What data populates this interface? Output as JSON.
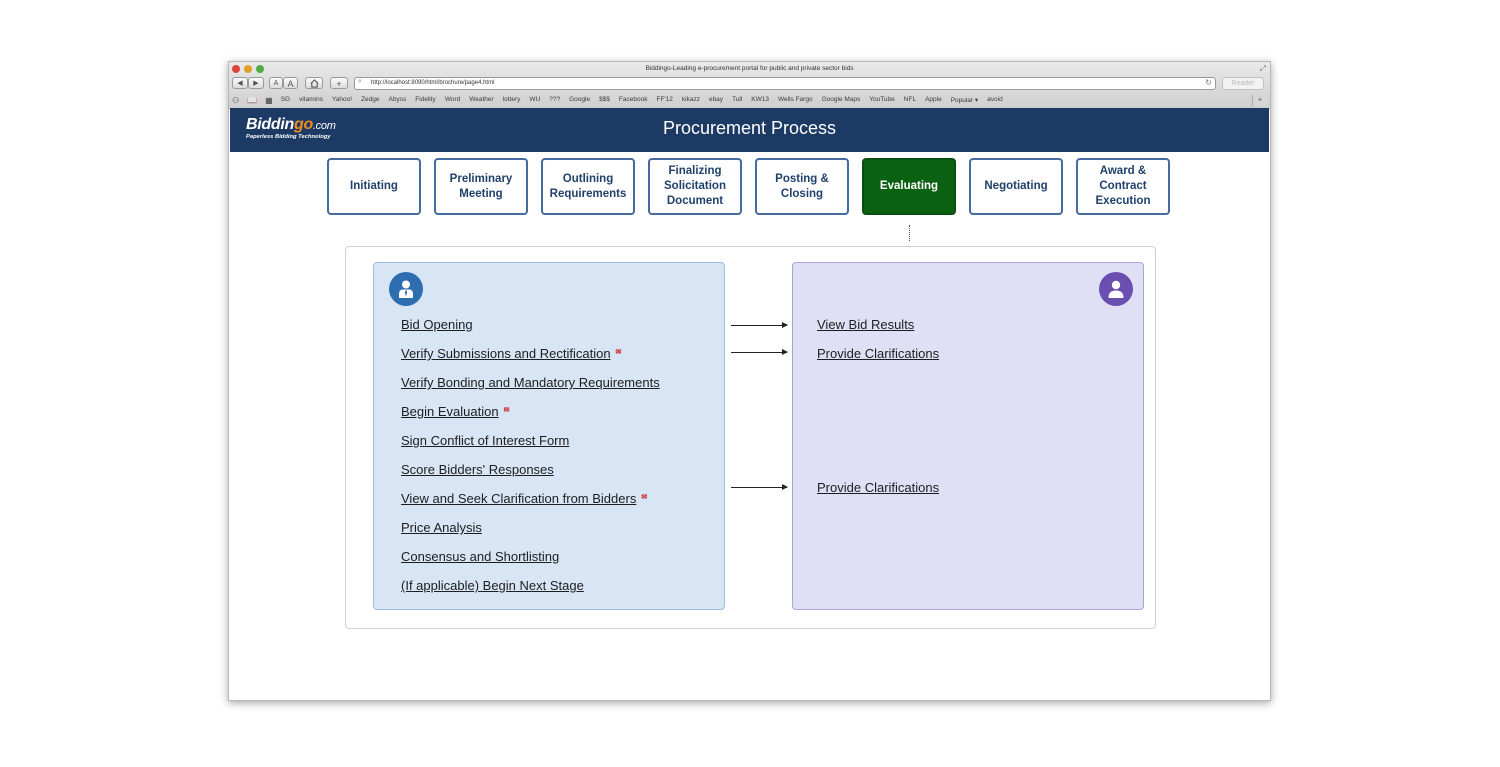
{
  "browser": {
    "window_title": "Biddingo-Leading e-procurement portal for public and private sector bids",
    "url": "http://localhost:8090/html/brochure/page4.html",
    "reader_label": "Reader",
    "font_smaller": "A",
    "font_larger": "A",
    "add_label": "+",
    "bookmarks": [
      "SG",
      "vitamins",
      "Yahoo!",
      "Zedge",
      "Abyss",
      "Fidelity",
      "Word",
      "Weather",
      "lottery",
      "WU",
      "???",
      "Google",
      "$$$",
      "Facebook",
      "FF'12",
      "kikazz",
      "ebay",
      "Tull",
      "KW13",
      "Wells Fargo",
      "Google Maps",
      "YouTube",
      "NFL",
      "Apple",
      "Popular ▾",
      "avoid"
    ]
  },
  "header": {
    "logo_text_1": "Biddin",
    "logo_text_2": "go",
    "logo_text_3": ".com",
    "logo_tagline": "Paperless Bidding Technology",
    "title": "Procurement Process"
  },
  "steps": [
    {
      "label": "Initiating",
      "active": false
    },
    {
      "label": "Preliminary Meeting",
      "active": false
    },
    {
      "label": "Outlining Requirements",
      "active": false
    },
    {
      "label": "Finalizing Solicitation Document",
      "active": false
    },
    {
      "label": "Posting & Closing",
      "active": false
    },
    {
      "label": "Evaluating",
      "active": true
    },
    {
      "label": "Negotiating",
      "active": false
    },
    {
      "label": "Award & Contract Execution",
      "active": false
    }
  ],
  "left_actions": [
    {
      "label": "Bid Opening",
      "mail": false
    },
    {
      "label": "Verify Submissions and Rectification",
      "mail": true
    },
    {
      "label": "Verify Bonding and Mandatory Requirements",
      "mail": false
    },
    {
      "label": "Begin Evaluation",
      "mail": true
    },
    {
      "label": "Sign Conflict of Interest Form",
      "mail": false
    },
    {
      "label": "Score Bidders' Responses",
      "mail": false
    },
    {
      "label": "View and Seek Clarification from Bidders",
      "mail": true
    },
    {
      "label": "Price Analysis",
      "mail": false
    },
    {
      "label": "Consensus and Shortlisting",
      "mail": false
    },
    {
      "label": "(If applicable) Begin Next Stage",
      "mail": false
    }
  ],
  "right_actions": [
    {
      "label": "View Bid Results"
    },
    {
      "label": "Provide Clarifications"
    },
    {
      "label": "Provide Clarifications"
    }
  ],
  "colors": {
    "header_bg": "#1c3a64",
    "active_step": "#0b6112",
    "left_panel": "#d7e5f5",
    "right_panel": "#dfe0f5",
    "mail_icon": "#d0191f"
  },
  "icons": {
    "left_avatar": "buyer-icon",
    "right_avatar": "bidder-icon",
    "mail": "mail-icon"
  }
}
